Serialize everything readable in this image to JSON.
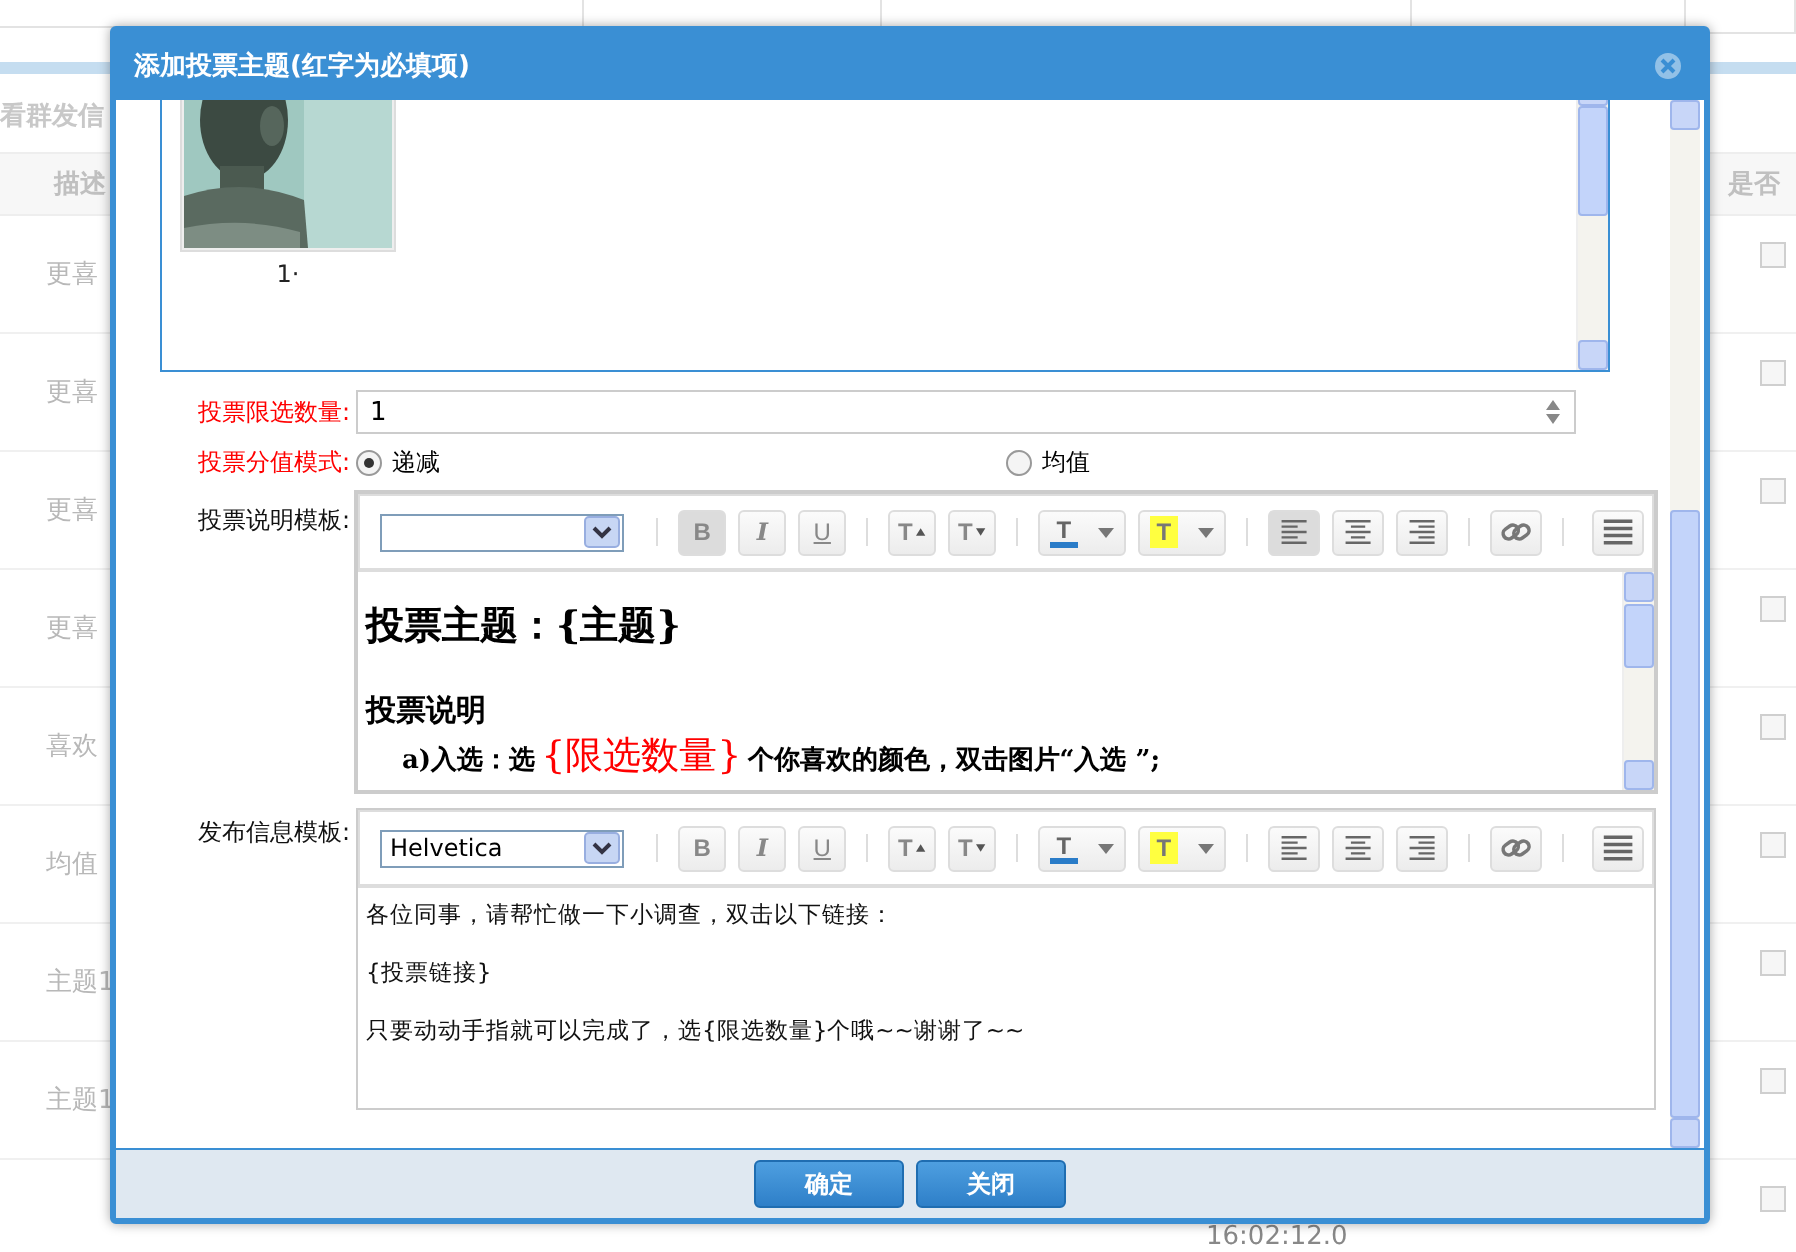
{
  "background": {
    "section_title": "看群发信",
    "columns": [
      "描述",
      "是否"
    ],
    "rows": [
      {
        "description": "更喜",
        "checked": false
      },
      {
        "description": "更喜",
        "checked": false
      },
      {
        "description": "更喜",
        "checked": false
      },
      {
        "description": "更喜",
        "checked": false
      },
      {
        "description": "喜欢",
        "checked": false
      },
      {
        "description": "均值",
        "checked": false
      },
      {
        "description": "主题1",
        "checked": false
      },
      {
        "description": "主题1",
        "checked": false
      },
      {
        "checked": false
      }
    ],
    "timestamp": "16:02:12.0"
  },
  "dialog": {
    "title": "添加投票主题(红字为必填项)",
    "images": [
      {
        "kind": "picture",
        "caption": "1·"
      }
    ],
    "limit": {
      "label": "投票限选数量:",
      "required": true,
      "value": "1"
    },
    "score_mode": {
      "label": "投票分值模式:",
      "required": true,
      "options": [
        {
          "label": "递减",
          "selected": true
        },
        {
          "label": "均值",
          "selected": false
        }
      ]
    },
    "editors": [
      {
        "label": "投票说明模板:",
        "required": false,
        "tools": [
          {
            "kind": "bold",
            "glyph": "B",
            "active": true
          },
          {
            "kind": "italic",
            "glyph": "I",
            "active": false
          },
          {
            "kind": "underline",
            "glyph": "U",
            "active": false
          },
          {
            "kind": "grow",
            "glyph": "T",
            "active": false
          },
          {
            "kind": "shrink",
            "glyph": "T",
            "active": false
          },
          {
            "kind": "color",
            "glyph": "T",
            "active": false
          },
          {
            "kind": "highlight",
            "glyph": "T",
            "active": false
          },
          {
            "kind": "align-left",
            "active": true
          },
          {
            "kind": "align-center",
            "active": false
          },
          {
            "kind": "align-right",
            "active": false
          },
          {
            "kind": "link",
            "active": false
          },
          {
            "kind": "more",
            "active": false
          }
        ],
        "blocks": [
          {
            "kind": "heading",
            "segments": [
              {
                "kind": "text",
                "text": "投票主题：{主题}"
              }
            ]
          },
          {
            "kind": "subheading",
            "segments": [
              {
                "kind": "text",
                "text": "投票说明"
              }
            ]
          },
          {
            "kind": "item",
            "segments": [
              {
                "kind": "text",
                "text": "a)入选：选"
              },
              {
                "kind": "variable",
                "text": "{限选数量}"
              },
              {
                "kind": "text",
                "text": "个你喜欢的颜色，双击图片“入选 ”;"
              }
            ]
          }
        ]
      },
      {
        "label": "发布信息模板:",
        "required": false,
        "font": "Helvetica",
        "tools": [
          {
            "kind": "bold",
            "glyph": "B",
            "active": false
          },
          {
            "kind": "italic",
            "glyph": "I",
            "active": false
          },
          {
            "kind": "underline",
            "glyph": "U",
            "active": false
          },
          {
            "kind": "grow",
            "glyph": "T",
            "active": false
          },
          {
            "kind": "shrink",
            "glyph": "T",
            "active": false
          },
          {
            "kind": "color",
            "glyph": "T",
            "active": false
          },
          {
            "kind": "highlight",
            "glyph": "T",
            "active": false
          },
          {
            "kind": "align-left",
            "active": false
          },
          {
            "kind": "align-center",
            "active": false
          },
          {
            "kind": "align-right",
            "active": false
          },
          {
            "kind": "link",
            "active": false
          },
          {
            "kind": "more",
            "active": false
          }
        ],
        "blocks": [
          {
            "kind": "paragraph",
            "segments": [
              {
                "kind": "text",
                "text": "各位同事，请帮忙做一下小调查，双击以下链接："
              }
            ]
          },
          {
            "kind": "paragraph",
            "segments": [
              {
                "kind": "text",
                "text": "{投票链接}"
              }
            ]
          },
          {
            "kind": "paragraph",
            "segments": [
              {
                "kind": "text",
                "text": "只要动动手指就可以完成了，选{限选数量}个哦~~谢谢了~~"
              }
            ]
          }
        ]
      }
    ],
    "buttons": [
      {
        "label": "确定"
      },
      {
        "label": "关闭"
      }
    ]
  }
}
